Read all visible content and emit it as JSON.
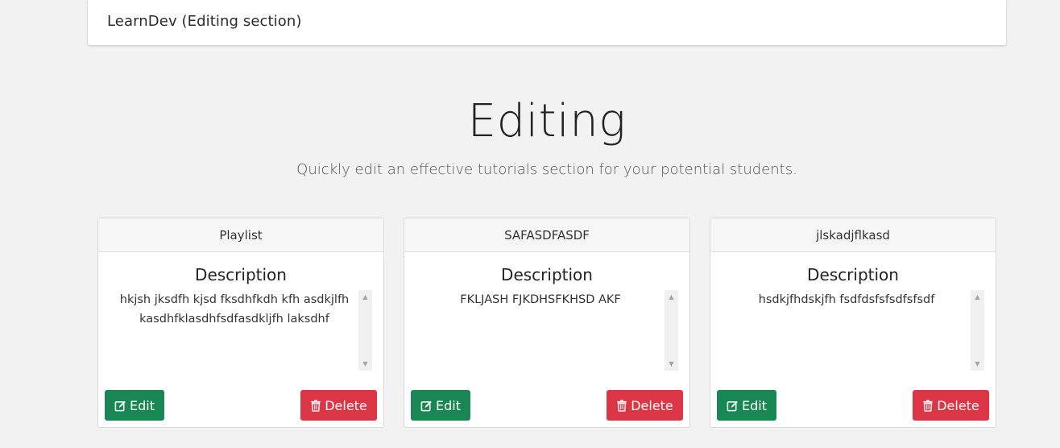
{
  "navbar": {
    "brand": "LearnDev (Editing section)"
  },
  "hero": {
    "title": "Editing",
    "subtitle": "Quickly edit an effective tutorials section for your potential students."
  },
  "cards": [
    {
      "header": "Playlist",
      "desc_title": "Description",
      "desc": "hkjsh jksdfh kjsd fksdhfkdh kfh asdkjlfh kasdhfklasdhfsdfasdkljfh laksdhf",
      "edit_label": "Edit",
      "delete_label": "Delete"
    },
    {
      "header": "SAFASDFASDF",
      "desc_title": "Description",
      "desc": "FKLJASH FJKDHSFKHSD AKF",
      "edit_label": "Edit",
      "delete_label": "Delete"
    },
    {
      "header": "jlskadjflkasd",
      "desc_title": "Description",
      "desc": "hsdkjfhdskjfh fsdfdsfsfsdfsfsdf",
      "edit_label": "Edit",
      "delete_label": "Delete"
    }
  ],
  "icons": {
    "edit": "edit-icon",
    "delete": "trash-icon",
    "scroll_up": "arrow-up-icon",
    "scroll_down": "arrow-down-icon"
  },
  "colors": {
    "edit_button": "#198754",
    "delete_button": "#dc3545",
    "background": "#f2f2f2"
  }
}
